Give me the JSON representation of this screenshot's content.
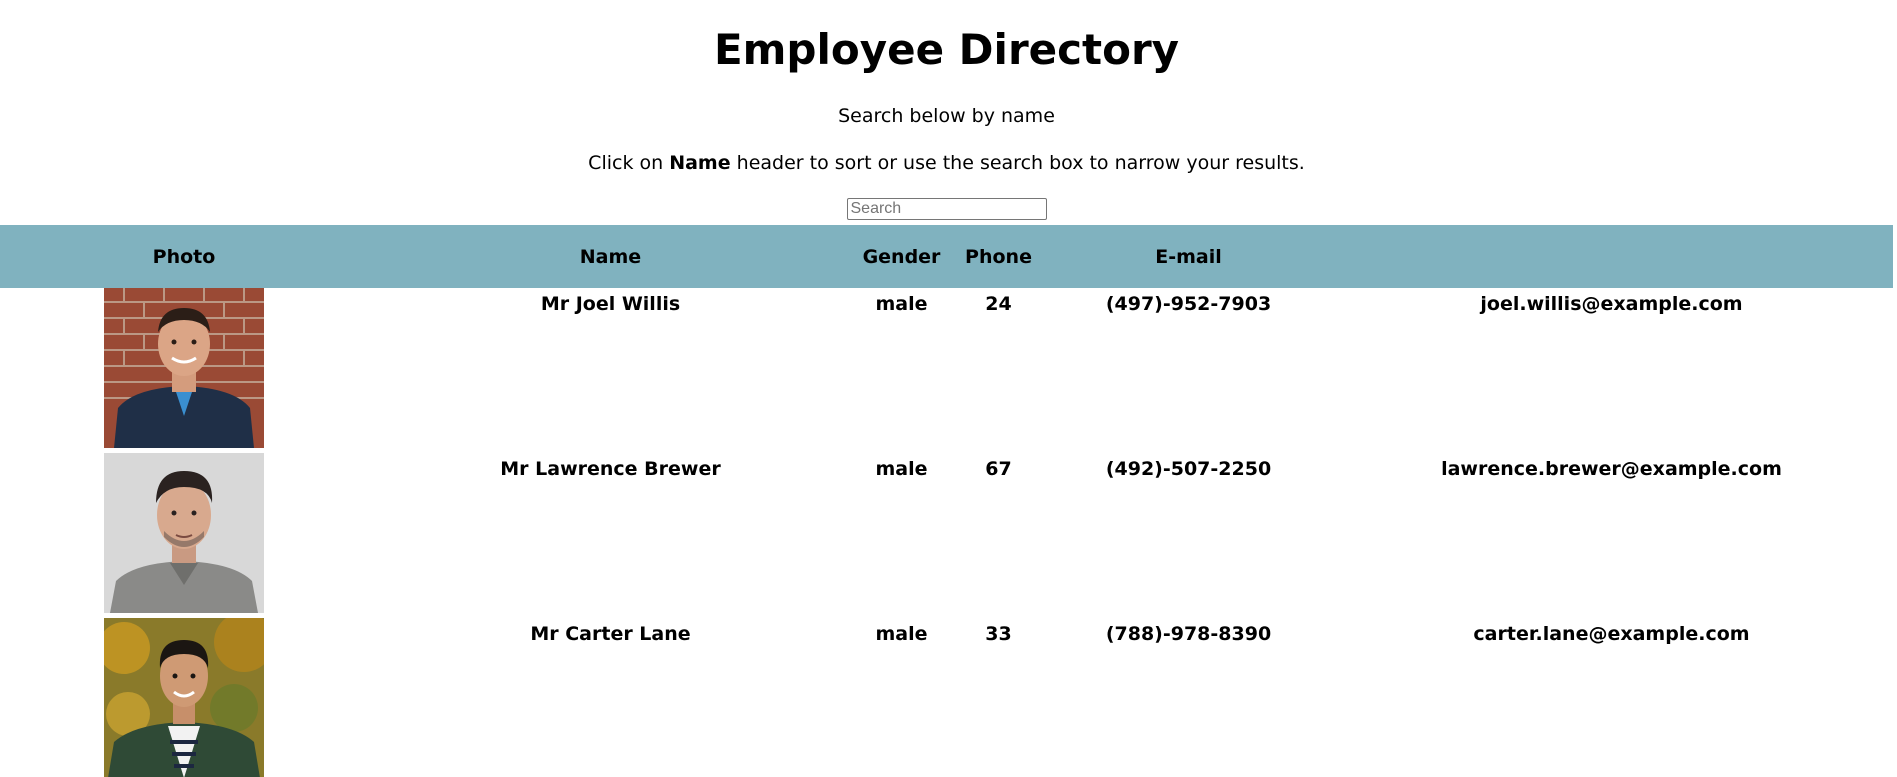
{
  "header": {
    "title": "Employee Directory",
    "subtitle": "Search below by name",
    "instructions": {
      "prefix": "Click on ",
      "emphasis": "Name",
      "suffix": " header to sort or use the search box to narrow your results."
    }
  },
  "search": {
    "placeholder": "Search",
    "value": ""
  },
  "table": {
    "columns": [
      "Photo",
      "Name",
      "Gender",
      "Phone",
      "E-mail"
    ],
    "header_color": "#80b2bf",
    "rows": [
      {
        "photo": "man-smiling-brick-wall-portrait",
        "name": "Mr Joel Willis",
        "gender": "male",
        "age": "24",
        "phone": "(497)-952-7903",
        "email": "joel.willis@example.com"
      },
      {
        "photo": "man-grey-background-portrait",
        "name": "Mr Lawrence Brewer",
        "gender": "male",
        "age": "67",
        "phone": "(492)-507-2250",
        "email": "lawrence.brewer@example.com"
      },
      {
        "photo": "man-autumn-trees-portrait",
        "name": "Mr Carter Lane",
        "gender": "male",
        "age": "33",
        "phone": "(788)-978-8390",
        "email": "carter.lane@example.com"
      }
    ]
  }
}
